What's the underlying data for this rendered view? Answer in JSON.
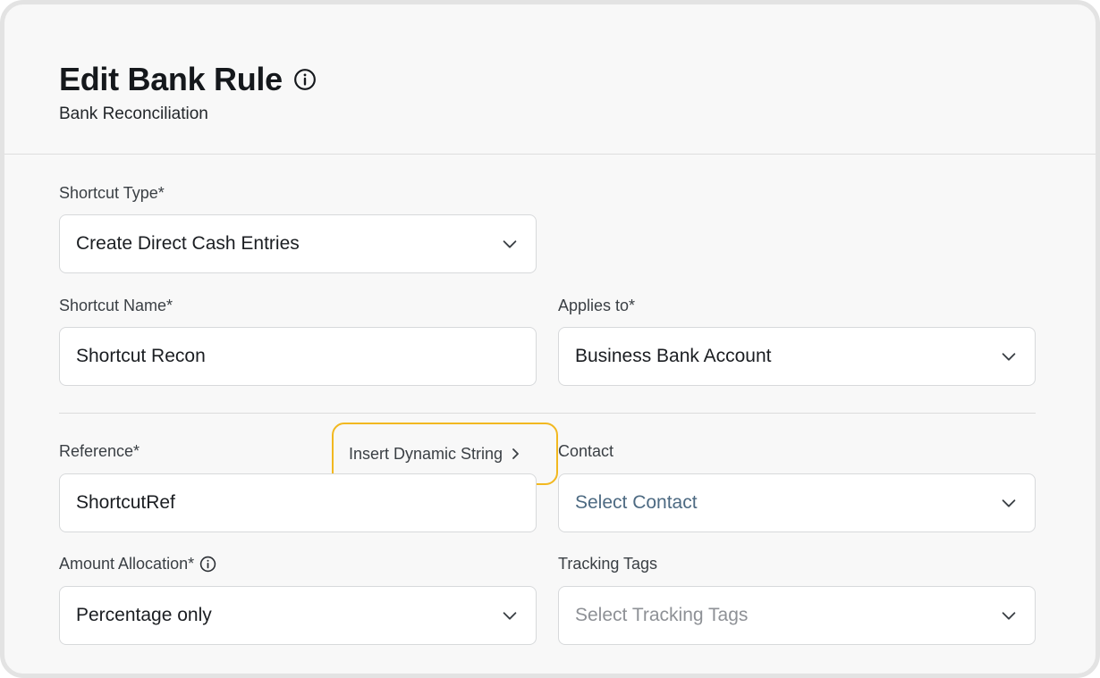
{
  "header": {
    "title": "Edit Bank Rule",
    "subtitle": "Bank Reconciliation"
  },
  "form": {
    "shortcut_type": {
      "label": "Shortcut Type*",
      "value": "Create Direct Cash Entries"
    },
    "shortcut_name": {
      "label": "Shortcut Name*",
      "value": "Shortcut Recon"
    },
    "applies_to": {
      "label": "Applies to*",
      "value": "Business Bank Account"
    },
    "reference": {
      "label": "Reference*",
      "value": "ShortcutRef"
    },
    "insert_dynamic_string": {
      "label": "Insert Dynamic String"
    },
    "contact": {
      "label": "Contact",
      "placeholder": "Select Contact"
    },
    "amount_allocation": {
      "label": "Amount Allocation*",
      "value": "Percentage only"
    },
    "tracking_tags": {
      "label": "Tracking Tags",
      "placeholder": "Select Tracking Tags"
    }
  },
  "colors": {
    "highlight": "#f2b820",
    "contact_placeholder": "#4d6a82",
    "muted_placeholder": "#8e9196"
  },
  "icons": [
    "info-icon",
    "chevron-down-icon",
    "chevron-right-icon"
  ]
}
